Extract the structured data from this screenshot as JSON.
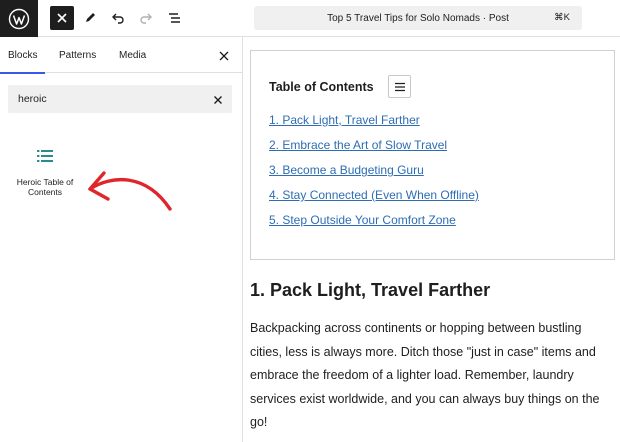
{
  "toolbar": {
    "document_title": "Top 5 Travel Tips for Solo Nomads · Post",
    "shortcut": "⌘K"
  },
  "sidebar": {
    "tabs": [
      {
        "label": "Blocks",
        "active": true
      },
      {
        "label": "Patterns",
        "active": false
      },
      {
        "label": "Media",
        "active": false
      }
    ],
    "search": {
      "value": "heroic",
      "placeholder": "Search"
    },
    "results": [
      {
        "label": "Heroic Table of Contents",
        "icon": "list-icon"
      }
    ]
  },
  "editor": {
    "toc": {
      "title": "Table of Contents",
      "items": [
        "1. Pack Light, Travel Farther",
        "2. Embrace the Art of Slow Travel",
        "3. Become a Budgeting Guru",
        "4. Stay Connected (Even When Offline)",
        "5. Step Outside Your Comfort Zone"
      ]
    },
    "heading": "1. Pack Light, Travel Farther",
    "paragraph": "Backpacking across continents or hopping between bustling cities, less is always more. Ditch those \"just in case\" items and embrace the freedom of a lighter load. Remember, laundry services exist worldwide, and you can always buy things on the go!"
  },
  "colors": {
    "accent": "#3858e9",
    "link": "#2e6db4",
    "block_icon": "#2c8c8c",
    "arrow": "#e0262b"
  }
}
